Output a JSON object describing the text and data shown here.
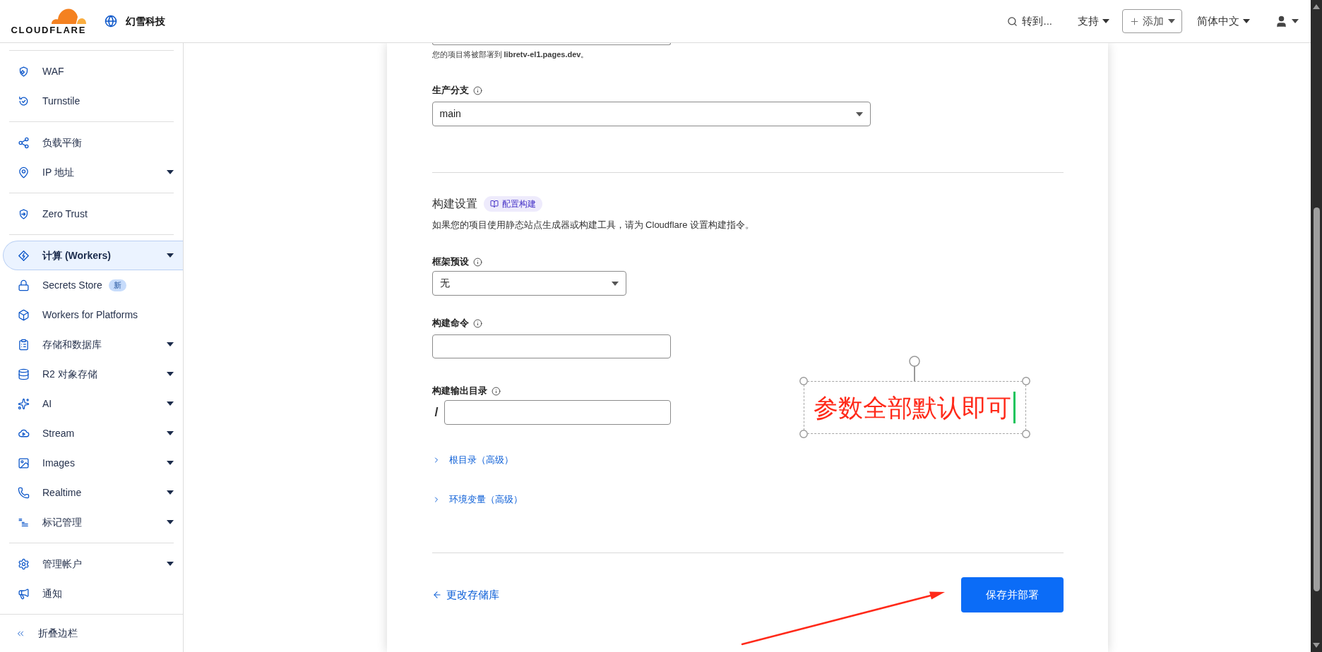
{
  "header": {
    "logo_text": "CLOUDFLARE",
    "account_name": "幻雪科技",
    "search_label": "转到...",
    "support_menu": "支持",
    "add_button": "添加",
    "language_menu": "简体中文"
  },
  "sidebar": {
    "sections": [
      {
        "items": [
          {
            "label": "WAF",
            "submenu": false,
            "selected": false
          },
          {
            "label": "Turnstile",
            "submenu": false,
            "selected": false
          }
        ]
      },
      {
        "items": [
          {
            "label": "负载平衡",
            "submenu": false,
            "selected": false
          },
          {
            "label": "IP 地址",
            "submenu": true,
            "selected": false
          }
        ]
      },
      {
        "items": [
          {
            "label": "Zero Trust",
            "submenu": false,
            "selected": false
          }
        ]
      },
      {
        "items": [
          {
            "label": "计算 (Workers)",
            "submenu": true,
            "selected": true
          },
          {
            "label": "Secrets Store",
            "submenu": false,
            "selected": false,
            "badge": "新"
          },
          {
            "label": "Workers for Platforms",
            "submenu": false,
            "selected": false
          },
          {
            "label": "存储和数据库",
            "submenu": true,
            "selected": false
          },
          {
            "label": "R2 对象存储",
            "submenu": true,
            "selected": false
          },
          {
            "label": "AI",
            "submenu": true,
            "selected": false
          },
          {
            "label": "Stream",
            "submenu": true,
            "selected": false
          },
          {
            "label": "Images",
            "submenu": true,
            "selected": false
          },
          {
            "label": "Realtime",
            "submenu": true,
            "selected": false
          },
          {
            "label": "标记管理",
            "submenu": true,
            "selected": false
          }
        ]
      },
      {
        "items": [
          {
            "label": "管理帐户",
            "submenu": true,
            "selected": false
          },
          {
            "label": "通知",
            "submenu": false,
            "selected": false
          }
        ]
      }
    ],
    "collapse_label": "折叠边栏"
  },
  "form": {
    "deploy_hint": "您的项目将被部署到 **libretv-el1.pages.dev**。",
    "production_branch": {
      "label": "生产分支",
      "value": "main"
    },
    "build_settings": {
      "title": "构建设置",
      "badge": "配置构建",
      "description": "如果您的项目使用静态站点生成器或构建工具，请为 Cloudflare 设置构建指令。"
    },
    "framework_preset": {
      "label": "框架预设",
      "value": "无"
    },
    "build_command": {
      "label": "构建命令"
    },
    "build_output": {
      "label": "构建输出目录",
      "prefix": "/"
    },
    "expanders": [
      {
        "label": "根目录（高级）",
        "expanded": false
      },
      {
        "label": "环境变量（高级）",
        "expanded": false
      }
    ],
    "back_link": "更改存储库",
    "submit_button": "保存并部署"
  },
  "annotation": {
    "text": "参数全部默认即可"
  }
}
